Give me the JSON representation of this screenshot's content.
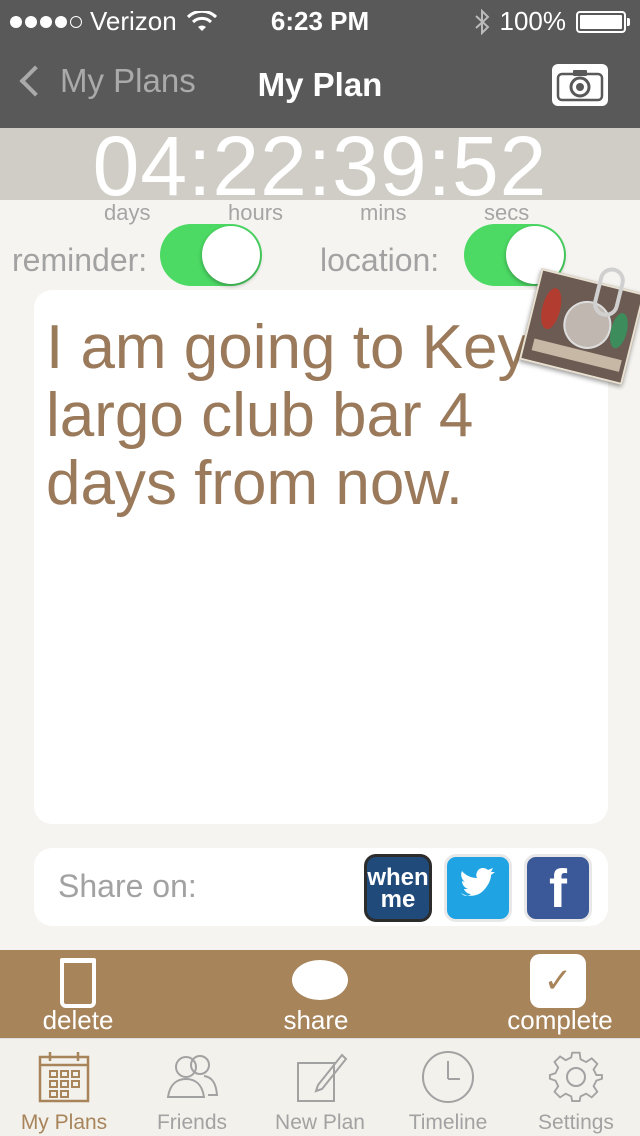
{
  "status_bar": {
    "carrier": "Verizon",
    "time": "6:23 PM",
    "battery": "100%"
  },
  "nav": {
    "back_label": "My Plans",
    "title": "My Plan"
  },
  "countdown": {
    "value": "04:22:39:52",
    "units": [
      "days",
      "hours",
      "mins",
      "secs"
    ]
  },
  "toggles": {
    "reminder_label": "reminder:",
    "location_label": "location:"
  },
  "plan": {
    "text": "I am going to Key largo club bar 4 days from now."
  },
  "share": {
    "label": "Share on:",
    "whenme_label": "when me",
    "facebook_glyph": "f"
  },
  "actions": {
    "delete": "delete",
    "share": "share",
    "complete": "complete"
  },
  "tabs": [
    {
      "label": "My Plans",
      "icon": "calendar-icon",
      "active": true
    },
    {
      "label": "Friends",
      "icon": "friends-icon",
      "active": false
    },
    {
      "label": "New Plan",
      "icon": "new-plan-icon",
      "active": false
    },
    {
      "label": "Timeline",
      "icon": "clock-icon",
      "active": false
    },
    {
      "label": "Settings",
      "icon": "gear-icon",
      "active": false
    }
  ],
  "colors": {
    "bar_dark": "#595959",
    "accent_brown": "#a8845b",
    "plan_text": "#9a7a5b",
    "toggle_on": "#4cd964"
  }
}
